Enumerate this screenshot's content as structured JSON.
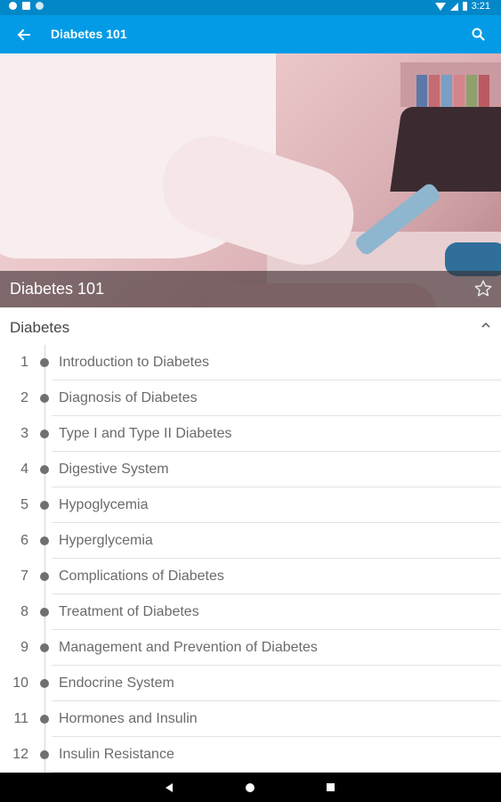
{
  "status_bar": {
    "time": "3:21",
    "icons": [
      "settings-icon",
      "sd-card-icon",
      "notification-dot-icon",
      "wifi-icon",
      "signal-icon",
      "battery-icon"
    ]
  },
  "app_bar": {
    "title": "Diabetes 101",
    "back_icon": "arrow-back-icon",
    "search_icon": "search-icon",
    "color": "#039be5"
  },
  "hero": {
    "title": "Diabetes 101",
    "favorite_icon": "star-outline-icon"
  },
  "section": {
    "title": "Diabetes",
    "toggle_icon": "chevron-up-icon"
  },
  "chapters": [
    {
      "number": "1",
      "title": "Introduction to Diabetes"
    },
    {
      "number": "2",
      "title": "Diagnosis of Diabetes"
    },
    {
      "number": "3",
      "title": "Type I and Type II Diabetes"
    },
    {
      "number": "4",
      "title": "Digestive System"
    },
    {
      "number": "5",
      "title": "Hypoglycemia"
    },
    {
      "number": "6",
      "title": "Hyperglycemia"
    },
    {
      "number": "7",
      "title": "Complications of Diabetes"
    },
    {
      "number": "8",
      "title": "Treatment of Diabetes"
    },
    {
      "number": "9",
      "title": "Management and Prevention of Diabetes"
    },
    {
      "number": "10",
      "title": "Endocrine System"
    },
    {
      "number": "11",
      "title": "Hormones and Insulin"
    },
    {
      "number": "12",
      "title": "Insulin Resistance"
    }
  ],
  "nav_bar": {
    "icons": [
      "nav-back-icon",
      "nav-home-icon",
      "nav-recents-icon"
    ]
  }
}
